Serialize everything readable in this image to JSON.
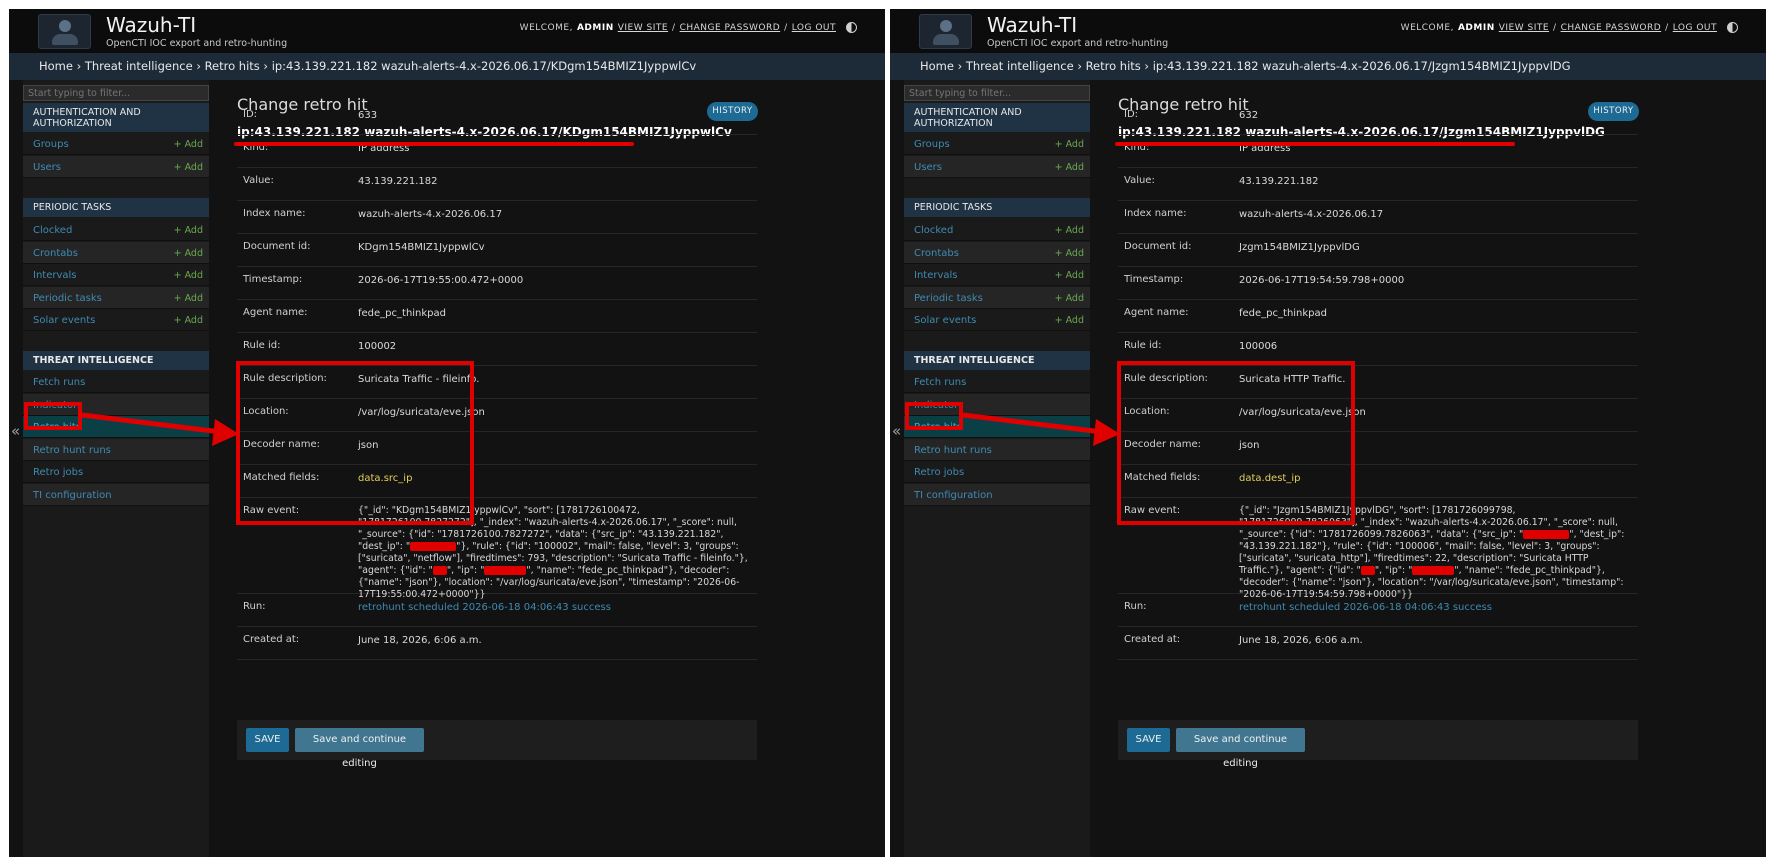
{
  "app": {
    "brand": "Wazuh-TI",
    "tagline": "OpenCTI IOC export and retro-hunting",
    "welcome": "WELCOME,",
    "user": "ADMIN",
    "view_site": "VIEW SITE",
    "change_password": "CHANGE PASSWORD",
    "log_out": "LOG OUT",
    "sep": "/"
  },
  "sidebar": {
    "filter_placeholder": "Start typing to filter...",
    "add_label": "Add",
    "collapse": "«",
    "sections": [
      {
        "caption": "AUTHENTICATION AND AUTHORIZATION",
        "items": [
          {
            "label": "Groups"
          },
          {
            "label": "Users"
          }
        ]
      },
      {
        "caption": "PERIODIC TASKS",
        "items": [
          {
            "label": "Clocked"
          },
          {
            "label": "Crontabs"
          },
          {
            "label": "Intervals"
          },
          {
            "label": "Periodic tasks"
          },
          {
            "label": "Solar events"
          }
        ]
      },
      {
        "caption": "THREAT INTELLIGENCE",
        "items": [
          {
            "label": "Fetch runs"
          },
          {
            "label": "Indicators"
          },
          {
            "label": "Retro hits"
          },
          {
            "label": "Retro hunt runs"
          },
          {
            "label": "Retro jobs"
          },
          {
            "label": "TI configuration"
          }
        ]
      }
    ]
  },
  "labels": {
    "page_title": "Change retro hit",
    "history": "HISTORY",
    "id": "ID:",
    "kind": "Kind:",
    "value": "Value:",
    "index_name": "Index name:",
    "document_id": "Document id:",
    "timestamp": "Timestamp:",
    "agent_name": "Agent name:",
    "rule_id": "Rule id:",
    "rule_description": "Rule description:",
    "location": "Location:",
    "decoder_name": "Decoder name:",
    "matched_fields": "Matched fields:",
    "raw_event": "Raw event:",
    "run": "Run:",
    "created_at": "Created at:",
    "save": "SAVE",
    "save_continue": "Save and continue editing"
  },
  "panels": [
    {
      "breadcrumb": "Home › Threat intelligence › Retro hits › ip:43.139.221.182 wazuh-alerts-4.x-2026.06.17/KDgm154BMIZ1JyppwlCv",
      "subtitle": "ip:43.139.221.182 wazuh-alerts-4.x-2026.06.17/KDgm154BMIZ1JyppwlCv",
      "fields": {
        "id": "633",
        "kind": "IP address",
        "value": "43.139.221.182",
        "index_name": "wazuh-alerts-4.x-2026.06.17",
        "document_id": "KDgm154BMIZ1JyppwlCv",
        "timestamp": "2026-06-17T19:55:00.472+0000",
        "agent_name": "fede_pc_thinkpad",
        "rule_id": "100002",
        "rule_description": "Suricata Traffic - fileinfo.",
        "location": "/var/log/suricata/eve.json",
        "decoder_name": "json",
        "matched_fields": "data.src_ip",
        "run": "retrohunt scheduled 2026-06-18 04:06:43 success",
        "created_at": "June 18, 2026, 6:06 a.m."
      },
      "raw": {
        "p1": "{\"_id\": \"KDgm154BMIZ1JyppwlCv\", \"sort\": [1781726100472, \"1781726100.7827272\"], \"_index\": \"wazuh-alerts-4.x-2026.06.17\", \"_score\": null, \"_source\": {\"id\": \"1781726100.7827272\", \"data\": {\"src_ip\": \"43.139.221.182\", \"dest_ip\": \"",
        "p2": "\"}, \"rule\": {\"id\": \"100002\", \"mail\": false, \"level\": 3, \"groups\": [\"suricata\", \"netflow\"], \"firedtimes\": 793, \"description\": \"Suricata Traffic - fileinfo.\"}, \"agent\": {\"id\": \"",
        "p3": "\", \"ip\": \"",
        "p4": "\", \"name\": \"fede_pc_thinkpad\"}, \"decoder\": {\"name\": \"json\"}, \"location\": \"/var/log/suricata/eve.json\", \"timestamp\": \"2026-06-17T19:55:00.472+0000\"}}"
      }
    },
    {
      "breadcrumb": "Home › Threat intelligence › Retro hits › ip:43.139.221.182 wazuh-alerts-4.x-2026.06.17/Jzgm154BMIZ1JyppvlDG",
      "subtitle": "ip:43.139.221.182 wazuh-alerts-4.x-2026.06.17/Jzgm154BMIZ1JyppvlDG",
      "fields": {
        "id": "632",
        "kind": "IP address",
        "value": "43.139.221.182",
        "index_name": "wazuh-alerts-4.x-2026.06.17",
        "document_id": "Jzgm154BMIZ1JyppvlDG",
        "timestamp": "2026-06-17T19:54:59.798+0000",
        "agent_name": "fede_pc_thinkpad",
        "rule_id": "100006",
        "rule_description": "Suricata HTTP Traffic.",
        "location": "/var/log/suricata/eve.json",
        "decoder_name": "json",
        "matched_fields": "data.dest_ip",
        "run": "retrohunt scheduled 2026-06-18 04:06:43 success",
        "created_at": "June 18, 2026, 6:06 a.m."
      },
      "raw": {
        "p1": "{\"_id\": \"Jzgm154BMIZ1JyppvlDG\", \"sort\": [1781726099798, \"1781726099.7826063\"], \"_index\": \"wazuh-alerts-4.x-2026.06.17\", \"_score\": null, \"_source\": {\"id\": \"1781726099.7826063\", \"data\": {\"src_ip\": \"",
        "p2": "\", \"dest_ip\": \"43.139.221.182\"}, \"rule\": {\"id\": \"100006\", \"mail\": false, \"level\": 3, \"groups\": [\"suricata\", \"suricata_http\"], \"firedtimes\": 22, \"description\": \"Suricata HTTP Traffic.\"}, \"agent\": {\"id\": \"",
        "p3": "\", \"ip\": \"",
        "p4": "\", \"name\": \"fede_pc_thinkpad\"}, \"decoder\": {\"name\": \"json\"}, \"location\": \"/var/log/suricata/eve.json\", \"timestamp\": \"2026-06-17T19:54:59.798+0000\"}}"
      }
    }
  ]
}
